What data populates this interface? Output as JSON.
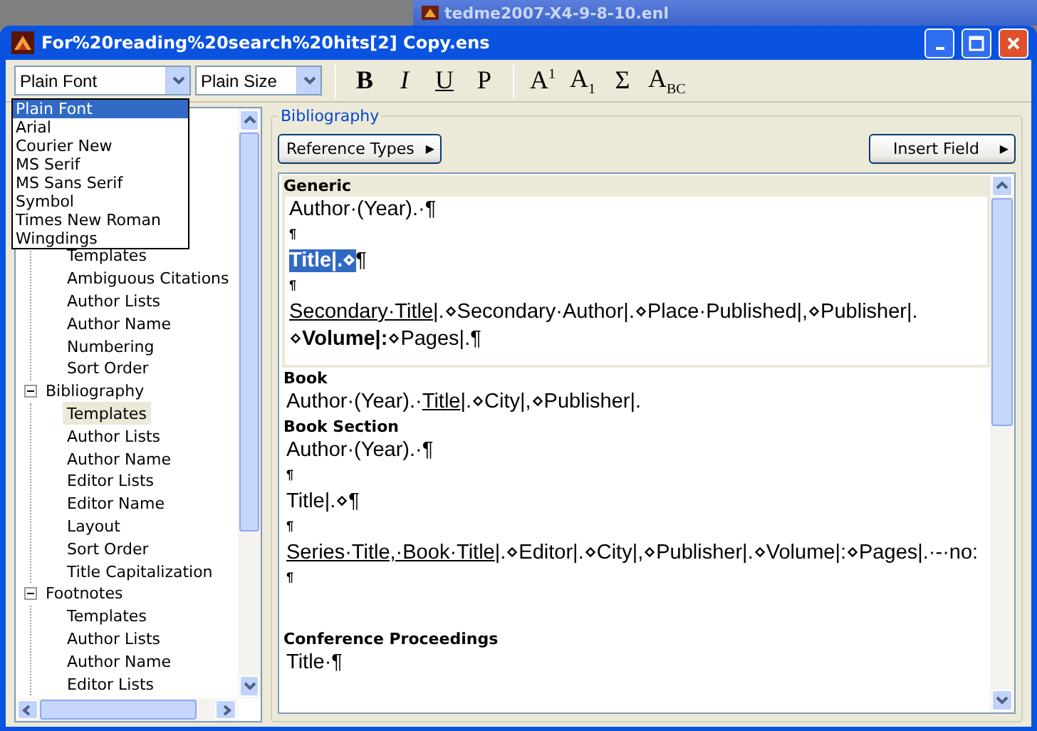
{
  "background_window": {
    "title": "tedme2007-X4-9-8-10.enl"
  },
  "window": {
    "title": "For%20reading%20search%20hits[2] Copy.ens"
  },
  "toolbar": {
    "font_combo": {
      "value": "Plain Font"
    },
    "size_combo": {
      "value": "Plain Size"
    },
    "buttons": [
      {
        "label": "B",
        "kind": "bold"
      },
      {
        "label": "I",
        "kind": "italic"
      },
      {
        "label": "U",
        "kind": "underline"
      },
      {
        "label": "P",
        "kind": "plain"
      },
      {
        "label": "A$^{1}$",
        "kind": "script"
      },
      {
        "label": "A$_{1}$",
        "kind": "script"
      },
      {
        "label": "Σ",
        "kind": "symbol"
      },
      {
        "label": "A$_{BC}$",
        "kind": "script"
      }
    ]
  },
  "font_dropdown": {
    "options": [
      {
        "label": "Plain Font",
        "selected": true
      },
      {
        "label": "Arial",
        "selected": false
      },
      {
        "label": "Courier New",
        "selected": false
      },
      {
        "label": "MS Serif",
        "selected": false
      },
      {
        "label": "MS Sans Serif",
        "selected": false
      },
      {
        "label": "Symbol",
        "selected": false
      },
      {
        "label": "Times New Roman",
        "selected": false
      },
      {
        "label": "Wingdings",
        "selected": false
      }
    ]
  },
  "tree": {
    "items": [
      {
        "children": [
          {
            "label": "Templates",
            "selected": false
          },
          {
            "label": "Ambiguous Citations",
            "selected": false
          },
          {
            "label": "Author Lists",
            "selected": false
          },
          {
            "label": "Author Name",
            "selected": false
          },
          {
            "label": "Numbering",
            "selected": false
          },
          {
            "label": "Sort Order",
            "selected": false
          }
        ]
      },
      {
        "label": "Bibliography",
        "expanded": true,
        "children": [
          {
            "label": "Templates",
            "selected": true
          },
          {
            "label": "Author Lists",
            "selected": false
          },
          {
            "label": "Author Name",
            "selected": false
          },
          {
            "label": "Editor Lists",
            "selected": false
          },
          {
            "label": "Editor Name",
            "selected": false
          },
          {
            "label": "Layout",
            "selected": false
          },
          {
            "label": "Sort Order",
            "selected": false
          },
          {
            "label": "Title Capitalization",
            "selected": false
          }
        ]
      },
      {
        "label": "Footnotes",
        "expanded": true,
        "children": [
          {
            "label": "Templates",
            "selected": false
          },
          {
            "label": "Author Lists",
            "selected": false
          },
          {
            "label": "Author Name",
            "selected": false
          },
          {
            "label": "Editor Lists",
            "selected": false
          }
        ]
      }
    ]
  },
  "panel": {
    "title": "Bibliography",
    "reference_types_button": "Reference Types",
    "insert_field_button": "Insert Field",
    "arrow": "▶",
    "templates": [
      {
        "heading": "Generic",
        "active": true,
        "lines": [
          {
            "kind": "text",
            "runs": [
              {
                "text": "Author·(Year).·¶",
                "kind": "plain"
              }
            ]
          },
          {
            "kind": "mark",
            "runs": [
              {
                "text": "¶",
                "kind": "plain"
              }
            ]
          },
          {
            "kind": "text",
            "runs": [
              {
                "text": "Title|.⋄",
                "kind": "selected"
              },
              {
                "text": "¶",
                "kind": "plain"
              }
            ]
          },
          {
            "kind": "mark",
            "runs": [
              {
                "text": "¶",
                "kind": "plain"
              }
            ]
          },
          {
            "kind": "text",
            "runs": [
              {
                "text": "Secondary·Title",
                "kind": "underline"
              },
              {
                "text": "|.⋄Secondary·Author|.⋄Place·Published|,⋄Publisher|.",
                "kind": "plain"
              }
            ]
          },
          {
            "kind": "text",
            "runs": [
              {
                "text": "⋄",
                "kind": "plain"
              },
              {
                "text": "Volume|:",
                "kind": "bold"
              },
              {
                "text": "⋄Pages|.¶",
                "kind": "plain"
              }
            ]
          }
        ]
      },
      {
        "heading": "Book",
        "active": false,
        "lines": [
          {
            "kind": "text",
            "runs": [
              {
                "text": "Author·(Year).·",
                "kind": "plain"
              },
              {
                "text": "Title",
                "kind": "underline"
              },
              {
                "text": "|.⋄City|,⋄Publisher|.",
                "kind": "plain"
              }
            ]
          }
        ]
      },
      {
        "heading": "Book Section",
        "active": false,
        "lines": [
          {
            "kind": "text",
            "runs": [
              {
                "text": "Author·(Year).·¶",
                "kind": "plain"
              }
            ]
          },
          {
            "kind": "mark",
            "runs": [
              {
                "text": "¶",
                "kind": "plain"
              }
            ]
          },
          {
            "kind": "text",
            "runs": [
              {
                "text": "Title|.⋄¶",
                "kind": "plain"
              }
            ]
          },
          {
            "kind": "mark",
            "runs": [
              {
                "text": "¶",
                "kind": "plain"
              }
            ]
          },
          {
            "kind": "text",
            "runs": [
              {
                "text": "Series·Title,·Book·Title",
                "kind": "underline"
              },
              {
                "text": "|.⋄Editor|.⋄City|,⋄Publisher|.⋄Volume|:⋄Pages|.·-·no:",
                "kind": "plain"
              }
            ]
          },
          {
            "kind": "mark",
            "runs": [
              {
                "text": "¶",
                "kind": "plain"
              }
            ]
          },
          {
            "kind": "blank"
          }
        ]
      },
      {
        "heading": "Conference Proceedings",
        "active": false,
        "lines": [
          {
            "kind": "text",
            "runs": [
              {
                "text": "Title·¶",
                "kind": "plain"
              }
            ]
          }
        ]
      }
    ]
  }
}
